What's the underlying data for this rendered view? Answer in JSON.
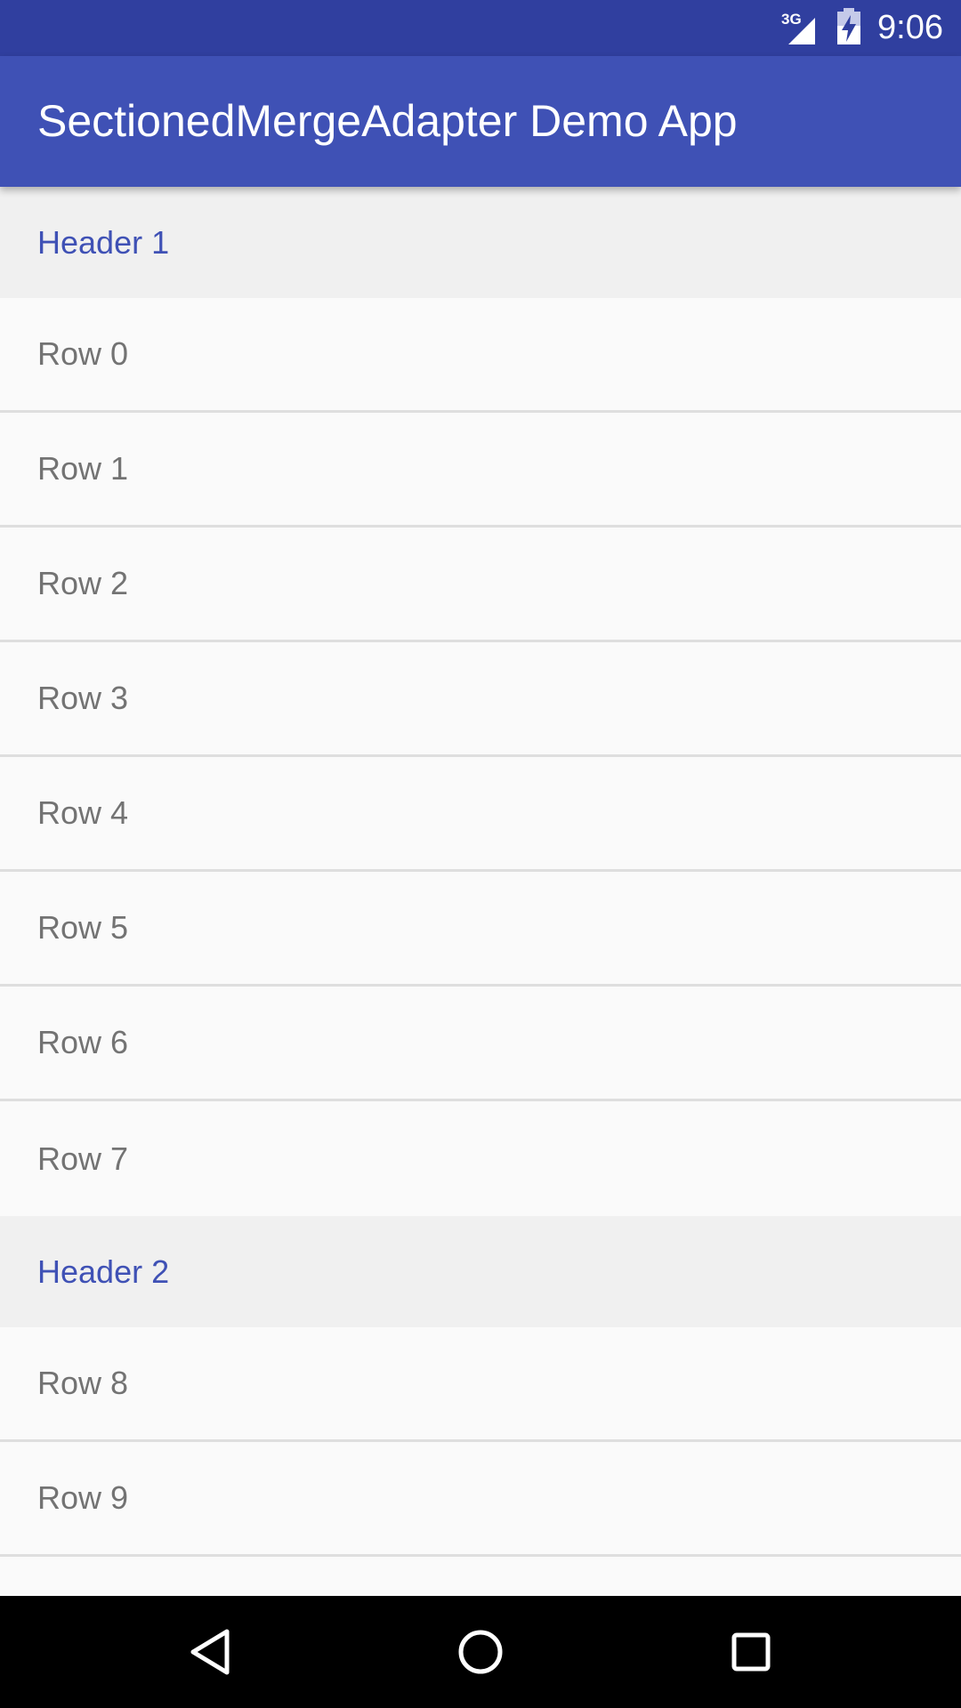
{
  "status_bar": {
    "network_type": "3G",
    "time": "9:06",
    "icons": [
      "signal-icon",
      "battery-charging-icon"
    ]
  },
  "app_bar": {
    "title": "SectionedMergeAdapter Demo App"
  },
  "sections": [
    {
      "header": "Header 1",
      "rows": [
        "Row 0",
        "Row 1",
        "Row 2",
        "Row 3",
        "Row 4",
        "Row 5",
        "Row 6",
        "Row 7"
      ]
    },
    {
      "header": "Header 2",
      "rows": [
        "Row 8",
        "Row 9"
      ]
    }
  ],
  "navigation": {
    "icons": [
      "back-icon",
      "home-icon",
      "recents-icon"
    ]
  },
  "colors": {
    "status_bar": "#303f9f",
    "primary": "#3f51b5",
    "header_bg": "#f0f0f0",
    "row_bg": "#fafafa",
    "row_text": "#737373",
    "divider": "#dedede"
  }
}
